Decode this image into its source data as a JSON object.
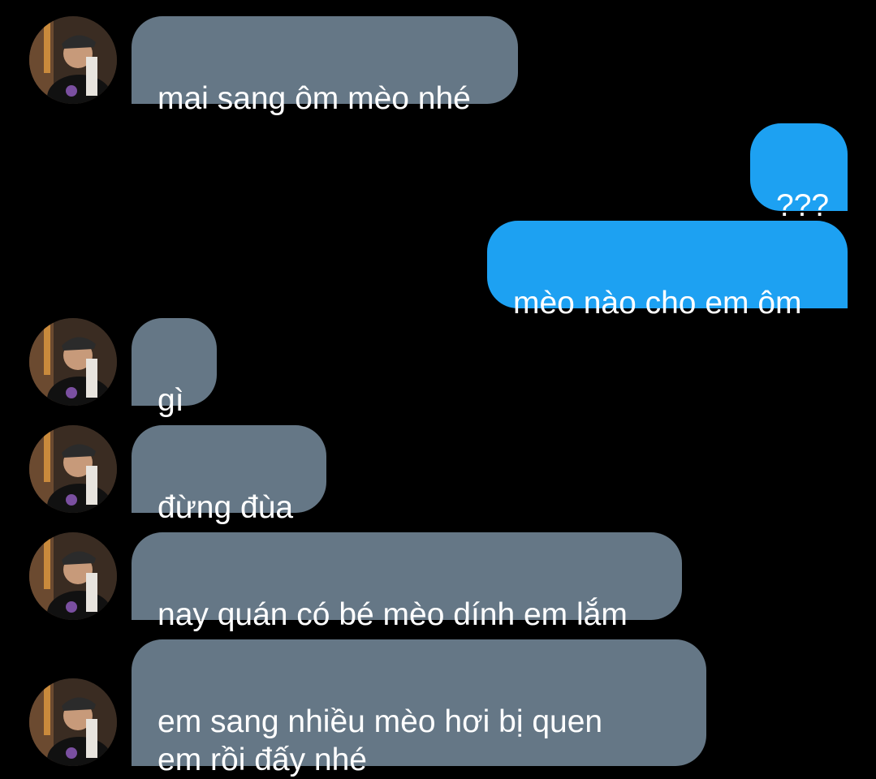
{
  "colors": {
    "background": "#000000",
    "incoming_bubble": "#657786",
    "outgoing_bubble": "#1da1f2",
    "text": "#ffffff"
  },
  "messages": [
    {
      "direction": "incoming",
      "text": "mai sang ôm mèo nhé"
    },
    {
      "direction": "outgoing",
      "text": "???"
    },
    {
      "direction": "outgoing",
      "text": "mèo nào cho em ôm"
    },
    {
      "direction": "incoming",
      "text": "gì"
    },
    {
      "direction": "incoming",
      "text": "đừng đùa"
    },
    {
      "direction": "incoming",
      "text": "nay quán có bé mèo dính em lắm"
    },
    {
      "direction": "incoming",
      "text": "em sang nhiều mèo hơi bị quen\nem rồi đấy nhé"
    }
  ],
  "avatar_icon": "contact-avatar-photo"
}
